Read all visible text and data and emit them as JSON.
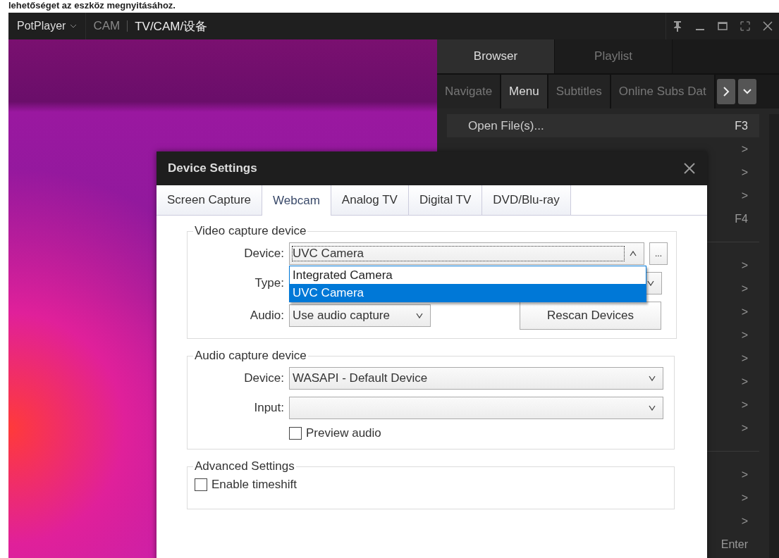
{
  "caption": "lehetőséget az eszköz megnyitásához.",
  "player": {
    "app_name": "PotPlayer",
    "breadcrumb": [
      "CAM",
      "TV/CAM/设备"
    ]
  },
  "panel": {
    "tabs": [
      {
        "label": "Browser",
        "selected": true
      },
      {
        "label": "Playlist",
        "selected": false
      }
    ],
    "subtabs": [
      {
        "label": "Navigate",
        "selected": false
      },
      {
        "label": "Menu",
        "selected": true
      },
      {
        "label": "Subtitles",
        "selected": false
      },
      {
        "label": "Online Subs Dat",
        "selected": false
      }
    ],
    "items": [
      {
        "kind": "item",
        "label": "Open File(s)...",
        "shortcut": "F3",
        "highlighted": true
      },
      {
        "kind": "item",
        "shortcut": ">",
        "highlighted": false
      },
      {
        "kind": "item",
        "shortcut": ">",
        "highlighted": false
      },
      {
        "kind": "item",
        "shortcut": ">",
        "highlighted": false
      },
      {
        "kind": "item",
        "shortcut": "F4",
        "highlighted": false
      },
      {
        "kind": "separator"
      },
      {
        "kind": "item",
        "shortcut": ">",
        "highlighted": false
      },
      {
        "kind": "item",
        "shortcut": ">",
        "highlighted": false
      },
      {
        "kind": "item",
        "shortcut": ">",
        "highlighted": false
      },
      {
        "kind": "item",
        "shortcut": ">",
        "highlighted": false
      },
      {
        "kind": "item",
        "shortcut": ">",
        "highlighted": false
      },
      {
        "kind": "item",
        "shortcut": ">",
        "highlighted": false
      },
      {
        "kind": "item",
        "shortcut": ">",
        "highlighted": false
      },
      {
        "kind": "item",
        "shortcut": ">",
        "highlighted": false
      },
      {
        "kind": "separator"
      },
      {
        "kind": "item",
        "shortcut": ">",
        "highlighted": false
      },
      {
        "kind": "item",
        "shortcut": ">",
        "highlighted": false
      },
      {
        "kind": "item",
        "shortcut": ">",
        "highlighted": false
      },
      {
        "kind": "item",
        "shortcut": "Enter",
        "highlighted": false
      }
    ]
  },
  "dialog": {
    "title": "Device Settings",
    "tabs": [
      {
        "label": "Screen Capture",
        "selected": false
      },
      {
        "label": "Webcam",
        "selected": true
      },
      {
        "label": "Analog TV",
        "selected": false
      },
      {
        "label": "Digital TV",
        "selected": false
      },
      {
        "label": "DVD/Blu-ray",
        "selected": false
      }
    ],
    "video_group": {
      "title": "Video capture device",
      "device_label": "Device:",
      "device_value": "UVC Camera",
      "expanded": true,
      "options": [
        {
          "label": "Integrated Camera",
          "selected": false
        },
        {
          "label": "UVC Camera",
          "selected": true
        }
      ],
      "more_button": "...",
      "type_label": "Type:",
      "audio_label": "Audio:",
      "audio_value": "Use audio capture",
      "rescan_button": "Rescan Devices"
    },
    "audio_group": {
      "title": "Audio capture device",
      "device_label": "Device:",
      "device_value": "WASAPI - Default Device",
      "input_label": "Input:",
      "preview": {
        "label": "Preview audio",
        "checked": false
      }
    },
    "advanced_group": {
      "title": "Advanced Settings",
      "timeshift": {
        "label": "Enable timeshift",
        "checked": false
      }
    }
  }
}
